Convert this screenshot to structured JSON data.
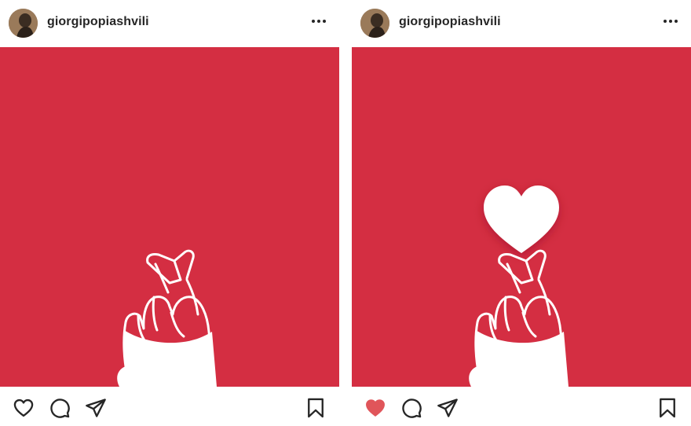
{
  "posts": [
    {
      "username": "giorgipopiashvili",
      "icons": {
        "avatar": "profile-photo-icon",
        "more": "more-options-icon",
        "like": "heart-outline-icon",
        "comment": "comment-icon",
        "share": "paper-plane-icon",
        "save": "bookmark-icon"
      },
      "liked": false,
      "image": "finger-heart-illustration",
      "colors": {
        "background": "#d42e42",
        "hand": "#ffffff"
      }
    },
    {
      "username": "giorgipopiashvili",
      "icons": {
        "avatar": "profile-photo-icon",
        "more": "more-options-icon",
        "like": "heart-filled-icon",
        "comment": "comment-icon",
        "share": "paper-plane-icon",
        "save": "bookmark-icon"
      },
      "liked": true,
      "image": "finger-heart-illustration-with-heart",
      "colors": {
        "background": "#d42e42",
        "hand": "#ffffff",
        "like_active": "#e0555a"
      }
    }
  ]
}
